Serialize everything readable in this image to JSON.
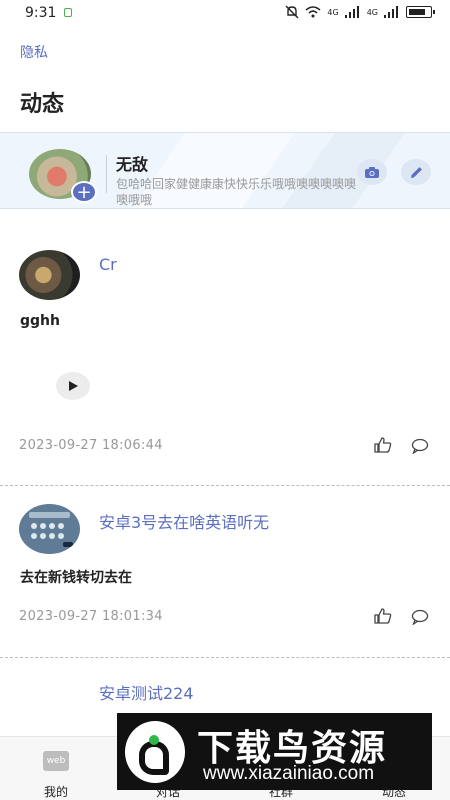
{
  "status_bar": {
    "time": "9:31",
    "network": "4G",
    "network2": "4G"
  },
  "header": {
    "privacy_link": "隐私",
    "title": "动态"
  },
  "profile": {
    "nickname": "无敌",
    "signature": "包哈哈回家健健康康快快乐乐哦哦噢噢噢噢噢噢哦哦",
    "add_icon": "plus-icon",
    "camera_icon": "camera-icon",
    "edit_icon": "pencil-icon"
  },
  "feed": [
    {
      "name": "Cr",
      "body": "gghh",
      "time": "2023-09-27 18:06:44",
      "has_audio": true
    },
    {
      "name": "安卓3号去在啥英语听无",
      "body": "去在新钱转切去在",
      "time": "2023-09-27 18:01:34",
      "has_audio": false
    },
    {
      "name": "安卓测试224"
    }
  ],
  "tabbar": {
    "tabs": [
      {
        "label": "我的",
        "icon": "web"
      },
      {
        "label": "对话"
      },
      {
        "label": "社群"
      },
      {
        "label": "动态"
      }
    ]
  },
  "watermark": {
    "title": "下载鸟资源",
    "url": "www.xiazainiao.com"
  },
  "colors": {
    "accent": "#5b6fc2",
    "card_bg": "#eef5fc",
    "time_gray": "#999999"
  }
}
